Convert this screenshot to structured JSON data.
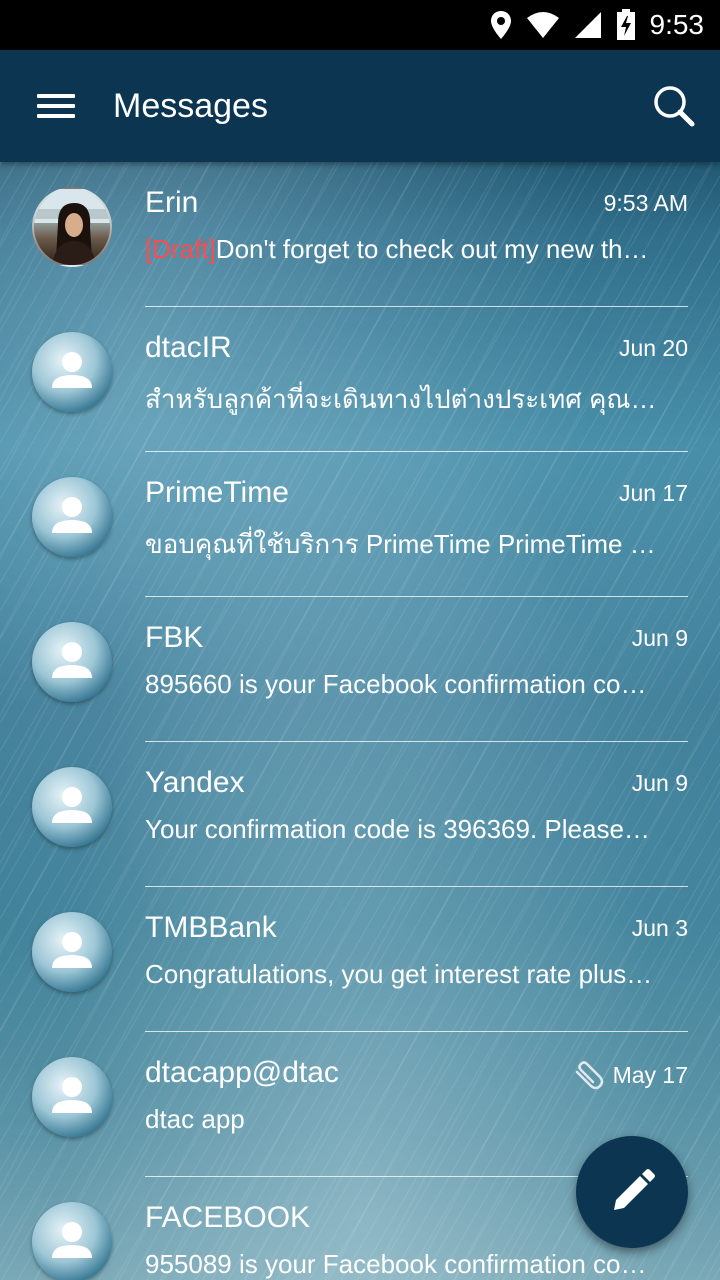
{
  "status_bar": {
    "time": "9:53",
    "icons": [
      "location-icon",
      "wifi-icon",
      "cell-signal-icon",
      "battery-charging-icon"
    ]
  },
  "app_bar": {
    "title": "Messages",
    "menu_icon": "menu-icon",
    "search_icon": "search-icon",
    "color": "#0b3550"
  },
  "conversations": [
    {
      "name": "Erin",
      "date": "9:53 AM",
      "draft_tag": "[Draft]",
      "preview": "Don't forget to check out my new th…",
      "avatar": "photo"
    },
    {
      "name": "dtacIR",
      "date": "Jun 20",
      "preview": "สำหรับลูกค้าที่จะเดินทางไปต่างประเทศ คุณ…",
      "avatar": "default"
    },
    {
      "name": "PrimeTime",
      "date": "Jun 17",
      "preview": "ขอบคุณที่ใช้บริการ PrimeTime PrimeTime …",
      "avatar": "default"
    },
    {
      "name": "FBK",
      "date": "Jun 9",
      "preview": "895660 is your Facebook confirmation co…",
      "avatar": "default"
    },
    {
      "name": "Yandex",
      "date": "Jun 9",
      "preview": "Your confirmation code is 396369. Please…",
      "avatar": "default"
    },
    {
      "name": "TMBBank",
      "date": "Jun 3",
      "preview": "Congratulations, you get interest rate plus…",
      "avatar": "default"
    },
    {
      "name": "dtacapp@dtac",
      "date": "May 17",
      "preview": "dtac app",
      "avatar": "default",
      "attachment_icon": "paperclip-icon"
    },
    {
      "name": "FACEBOOK",
      "date": "",
      "preview": "955089 is your Facebook confirmation co…",
      "avatar": "default"
    }
  ],
  "fab": {
    "icon": "pencil-icon",
    "color": "#0b3550"
  },
  "colors": {
    "draft": "#ff4b4b",
    "text": "#ffffff"
  }
}
